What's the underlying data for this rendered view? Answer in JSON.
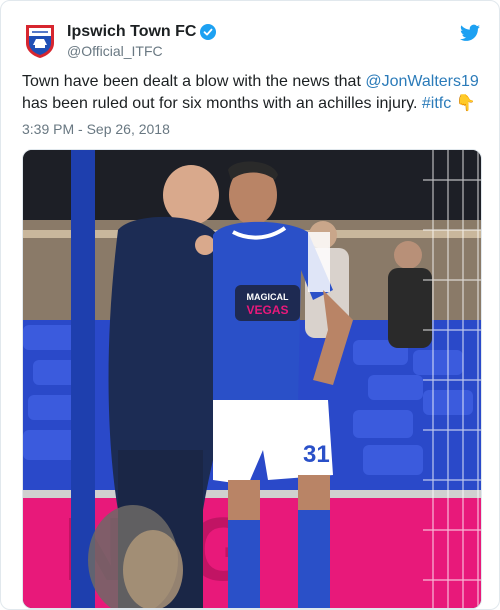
{
  "tweet": {
    "display_name": "Ipswich Town FC",
    "handle": "@Official_ITFC",
    "text_before": "Town have been dealt a blow with the news that ",
    "mention": "@JonWalters19",
    "text_middle": " has been ruled out for six months with an achilles injury. ",
    "hashtag": "#itfc",
    "emoji": "👇",
    "timestamp": "3:39 PM - Sep 26, 2018"
  },
  "photo": {
    "shirt_sponsor_line1": "MAGICAL",
    "shirt_sponsor_line2": "VEGAS",
    "shorts_number": "31"
  },
  "icons": {
    "avatar": "club-crest-icon",
    "verified": "verified-badge-icon",
    "brand": "twitter-bird-icon"
  },
  "colors": {
    "link": "#2b7bb9",
    "verified": "#1da1f2",
    "twitter_bird": "#1da1f2",
    "ipswich_blue": "#1f4fb5"
  }
}
